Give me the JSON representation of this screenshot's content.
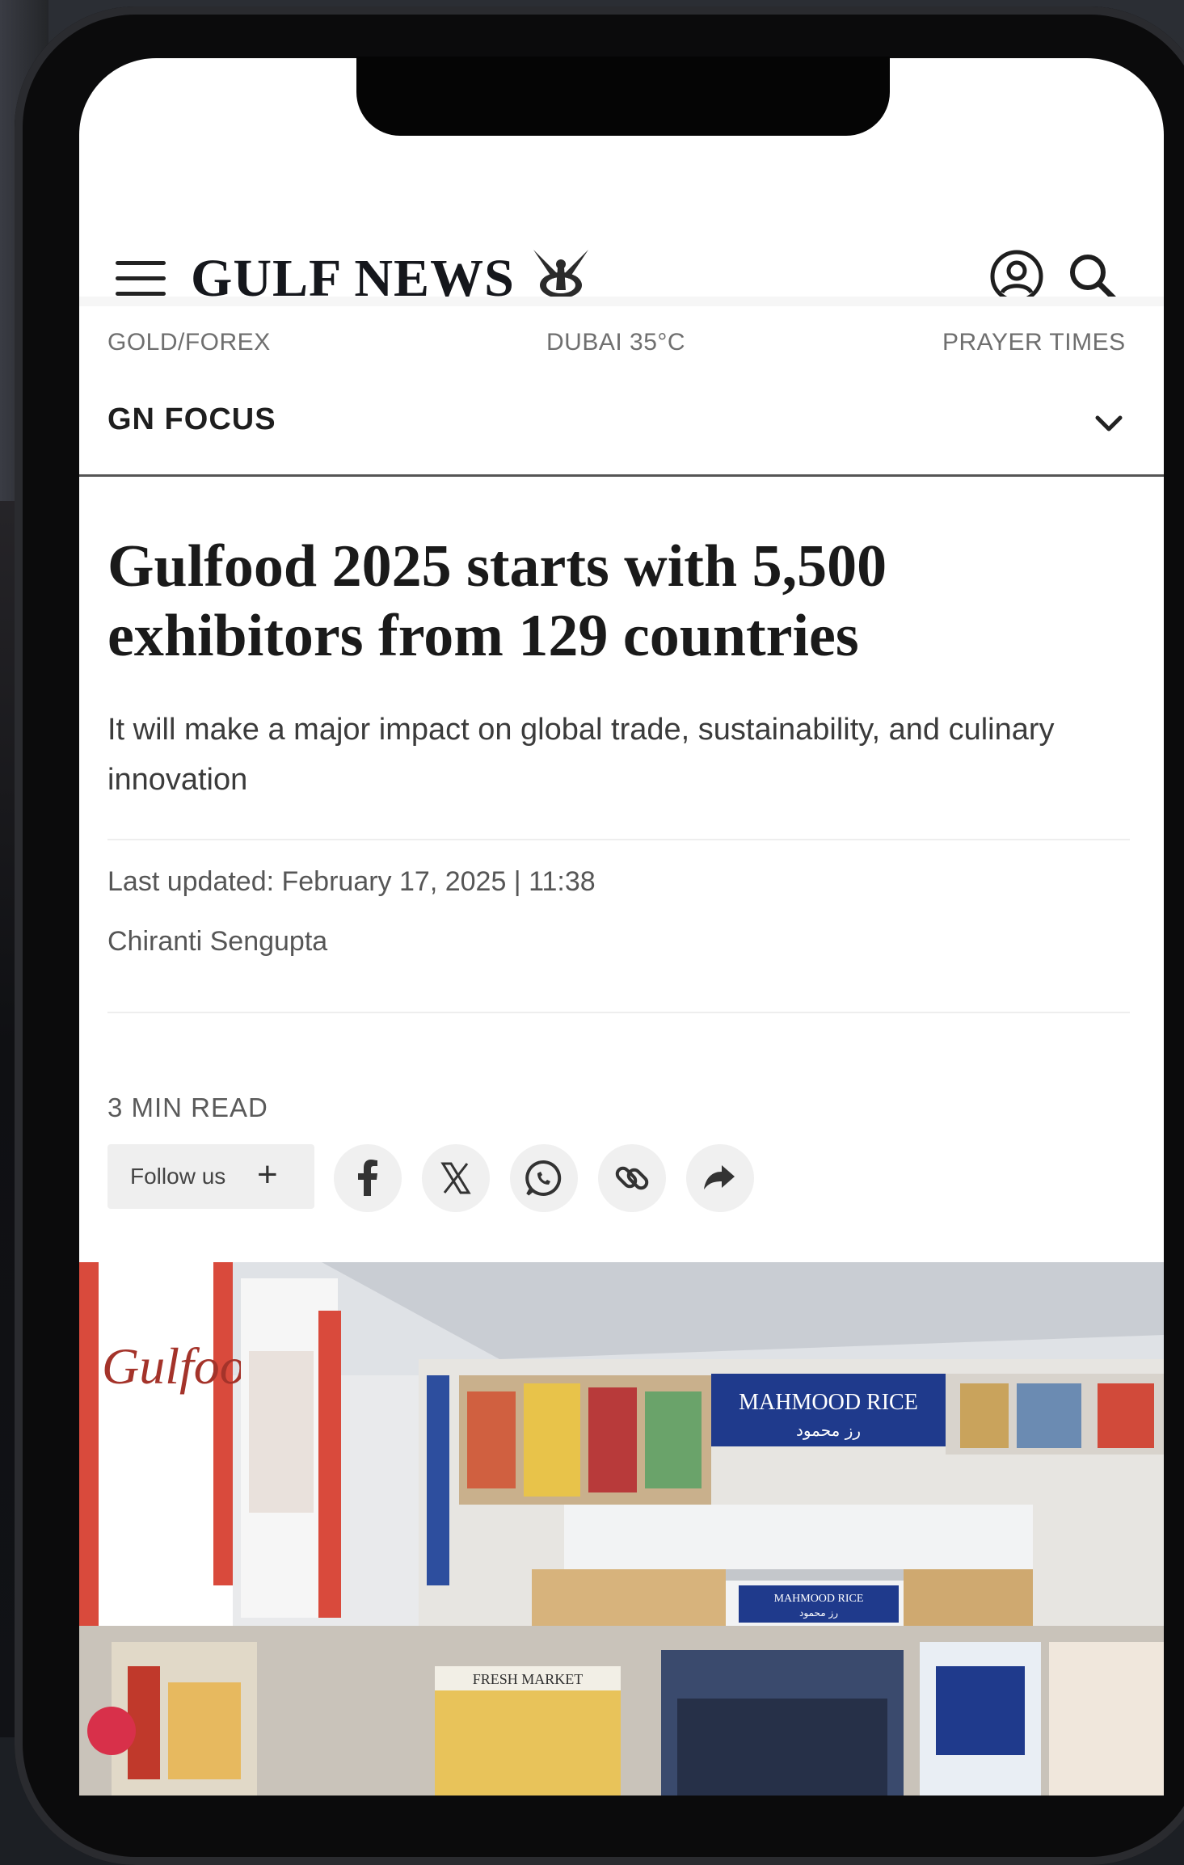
{
  "header": {
    "logo_text": "GULF NEWS",
    "emblem": "falcon-emblem",
    "icons": [
      "menu-icon",
      "profile-icon",
      "search-icon"
    ]
  },
  "utility_bar": {
    "left": "GOLD/FOREX",
    "center": "DUBAI 35°C",
    "right": "PRAYER TIMES"
  },
  "section": {
    "label": "GN FOCUS",
    "icon": "chevron-down-icon"
  },
  "article": {
    "headline": "Gulfood 2025 starts with 5,500 exhibitors from 129 countries",
    "subheadline": "It will make a major impact on global trade, sustainability, and culinary innovation",
    "updated": "Last updated: February 17, 2025 | 11:38",
    "author": "Chiranti Sengupta",
    "read_time": "3 MIN READ"
  },
  "social": {
    "follow_label": "Follow us",
    "follow_plus": "+",
    "share_icons": [
      "facebook-icon",
      "x-icon",
      "whatsapp-icon",
      "link-icon",
      "share-icon"
    ]
  },
  "photo": {
    "banner_main": "MAHMOOD RICE",
    "banner_main_ar": "رز محمود",
    "banner_left": "Gulfood",
    "banner_lower": "MAHMOOD RICE",
    "banner_lower_ar": "رز محمود",
    "stall_sign": "FRESH MARKET",
    "colors": {
      "banner_blue": "#1f3a8c",
      "banner_red": "#d62828"
    }
  }
}
